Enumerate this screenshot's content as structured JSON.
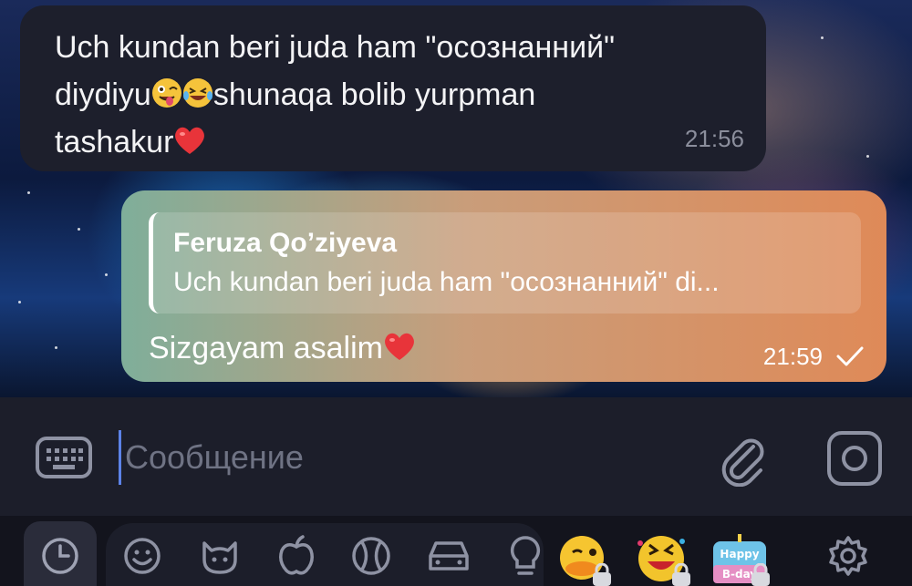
{
  "messages": [
    {
      "direction": "incoming",
      "line1": "Uch kundan beri juda ham \"осознанний\"",
      "line2_a": "diydiyu",
      "line2_b": "shunaqa bolib yurpman",
      "line3": "tashakur",
      "time": "21:56"
    },
    {
      "direction": "outgoing",
      "reply_author": "Feruza Qo’ziyeva",
      "reply_text": "Uch kundan beri juda ham \"осознанний\" di...",
      "text": "Sizgayam asalim",
      "time": "21:59",
      "status": "sent"
    }
  ],
  "composer": {
    "placeholder": "Сообщение"
  },
  "emoji_panel": {
    "tabs": [
      "recent-icon",
      "smiley-icon",
      "cat-icon",
      "apple-icon",
      "ball-icon",
      "car-icon",
      "bulb-icon"
    ],
    "stickers": [
      "duck-sticker",
      "smiley-sticker",
      "birthday-sticker"
    ],
    "birthday_sticker_text": "Happy B-day"
  },
  "colors": {
    "incoming_bubble": "#1d1f2c",
    "outgoing_start": "#7fae9a",
    "outgoing_end": "#df8a58",
    "caret": "#5c83e8"
  }
}
